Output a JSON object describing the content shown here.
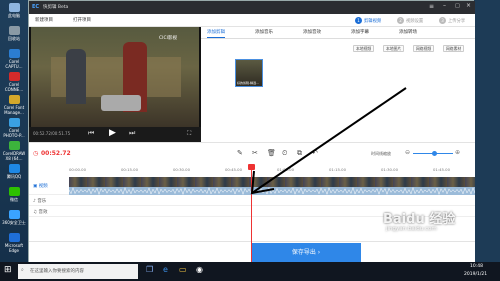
{
  "desktop": {
    "icons": [
      {
        "label": "此电脑",
        "color": "#8fb6e0"
      },
      {
        "label": "回收站",
        "color": "#8a9aa5"
      },
      {
        "label": "Corel CAPTU...",
        "color": "#2b7dd1"
      },
      {
        "label": "Corel CONNE...",
        "color": "#d42b2b"
      },
      {
        "label": "Corel Font Manage...",
        "color": "#d4a82b"
      },
      {
        "label": "Corel PHOTO-P...",
        "color": "#3aa0e3"
      },
      {
        "label": "CorelDRAW X8 (64...",
        "color": "#3cb33c"
      },
      {
        "label": "腾讯QQ",
        "color": "#1e88e5"
      },
      {
        "label": "微信",
        "color": "#2dc100"
      },
      {
        "label": "360安全卫士",
        "color": "#3aa3ff"
      },
      {
        "label": "Microsoft Edge",
        "color": "#1f6fd8"
      }
    ]
  },
  "app": {
    "logo": "EC",
    "name": "快剪辑 Beta",
    "menu": {
      "new_project": "新建项目",
      "open_project": "打开项目"
    },
    "steps": [
      {
        "num": "1",
        "label": "剪辑视频"
      },
      {
        "num": "2",
        "label": "视频设置"
      },
      {
        "num": "3",
        "label": "上传分享"
      }
    ],
    "player": {
      "time": "00:52.72/00:51.75",
      "watermark": "CICI影视"
    },
    "right_tabs": [
      "添加剪辑",
      "添加音乐",
      "添加音效",
      "添加字幕",
      "添加转场"
    ],
    "right_buttons": [
      "本地视频",
      "本地图片",
      "网络视频",
      "网络素材"
    ],
    "clip_caption": "好的剪辑-精选...",
    "timeline": {
      "current_time": "00:52.72",
      "ticks": [
        "00:00.00",
        "00:15.00",
        "00:30.00",
        "00:45.00",
        "01:00.00",
        "01:15.00",
        "01:30.00",
        "01:45.00"
      ],
      "zoom_label": "时间线缩放",
      "tracks": {
        "video": "视频",
        "music": "音乐",
        "sound": "音效"
      }
    },
    "save_label": "保存导出"
  },
  "taskbar": {
    "search_placeholder": "在这里输入你要搜索的内容",
    "time": "10:48",
    "date": "2019/1/21"
  },
  "watermark": {
    "site": "jingyan.baidu.com",
    "brand": "Baidu 经验"
  }
}
